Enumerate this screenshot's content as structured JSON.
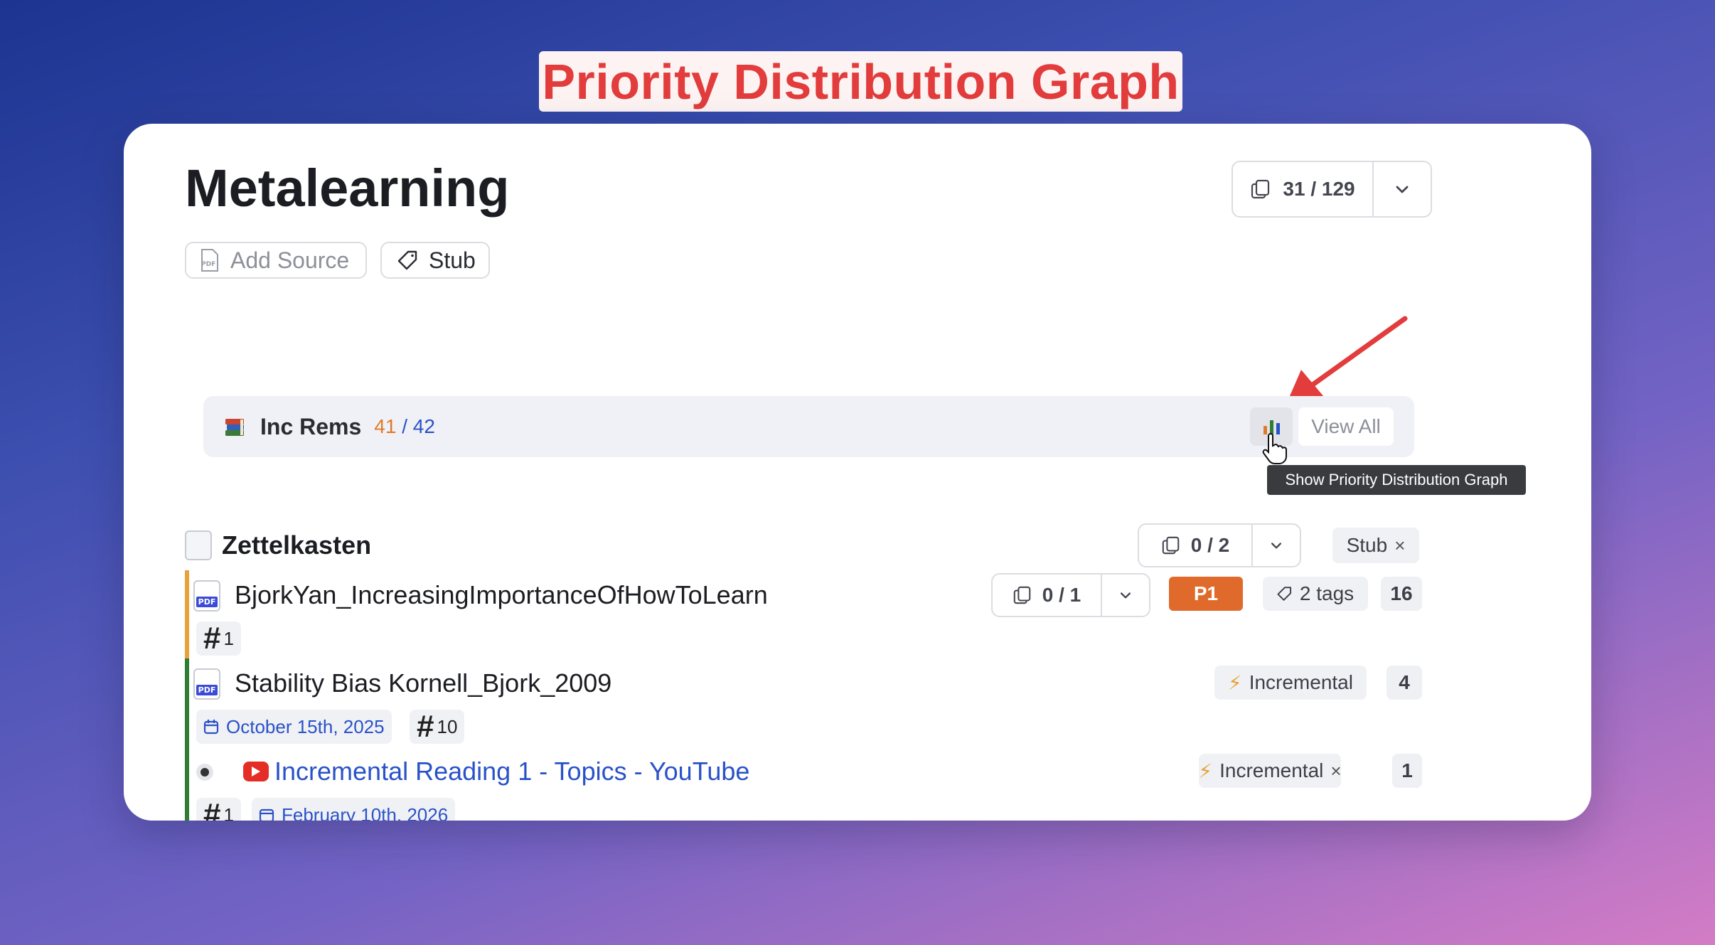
{
  "banner": {
    "title": "Priority Distribution Graph"
  },
  "page": {
    "title": "Metalearning",
    "add_source_label": "Add Source",
    "pdf_badge": "PDF",
    "stub_label": "Stub",
    "counter": "31 / 129"
  },
  "inc_rems": {
    "label": "Inc Rems",
    "done": "41",
    "sep": " / ",
    "total": "42",
    "view_all": "View All",
    "tooltip": "Show Priority Distribution Graph"
  },
  "tree": {
    "folder": {
      "title": "Zettelkasten",
      "counter": "0 / 2",
      "tag": "Stub"
    },
    "items": [
      {
        "title": "BjorkYan_IncreasingImportanceOfHowToLearn",
        "counter": "0 / 1",
        "priority": "P1",
        "tags": "2 tags",
        "count": "16",
        "hash": "1",
        "bar_color": "#e8a23a"
      },
      {
        "title": "Stability Bias Kornell_Bjork_2009",
        "type": "Incremental",
        "count": "4",
        "date": "October 15th, 2025",
        "hash": "10",
        "bar_color": "#2e7d32"
      },
      {
        "title": "Incremental Reading 1 - Topics - YouTube",
        "type": "Incremental",
        "count": "1",
        "hash": "1",
        "date": "February 10th, 2026"
      }
    ]
  },
  "colors": {
    "priority_bg": "#e06a2c",
    "accent_blue": "#2a52c8",
    "done_orange": "#e07a2a",
    "arrow_red": "#e23c3c"
  }
}
